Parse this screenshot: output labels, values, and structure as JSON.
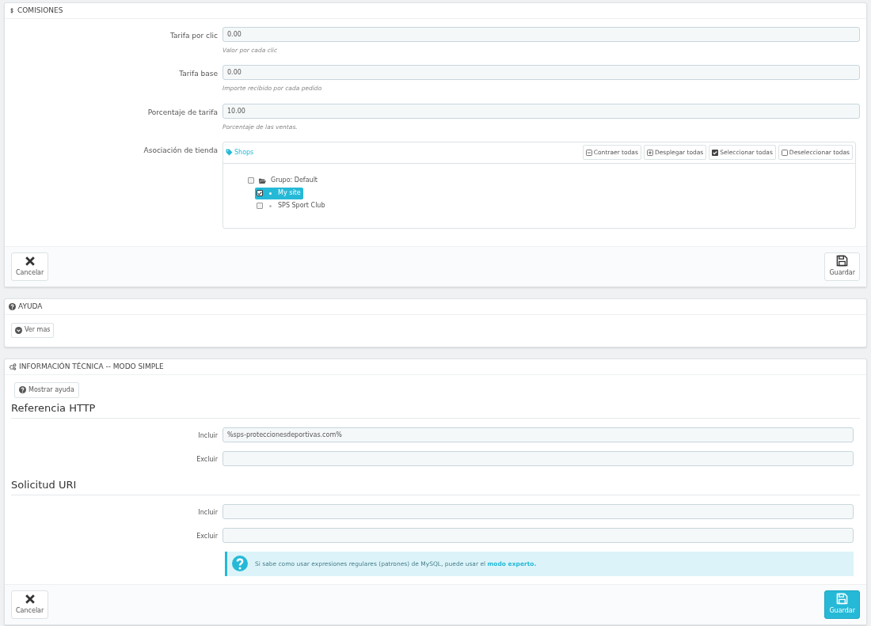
{
  "comisiones": {
    "title": "COMISIONES",
    "fields": [
      {
        "label": "Tarifa por clic",
        "value": "0.00",
        "help": "Valor por cada clic"
      },
      {
        "label": "Tarifa base",
        "value": "0.00",
        "help": "Importe recibido por cada pedido"
      },
      {
        "label": "Porcentaje de tarifa",
        "value": "10.00",
        "help": "Porcentaje de las ventas."
      }
    ],
    "shop_association": {
      "label": "Asociación de tienda",
      "tree_title": "Shops",
      "actions": [
        {
          "label": "Contraer todas",
          "kind": "collapse"
        },
        {
          "label": "Desplegar todas",
          "kind": "expand"
        },
        {
          "label": "Seleccionar todas",
          "kind": "check"
        },
        {
          "label": "Deseleccionar todas",
          "kind": "uncheck"
        }
      ],
      "tree": [
        {
          "label": "Grupo: Default",
          "checked": false,
          "selected": false,
          "children": [
            {
              "label": "My site",
              "checked": true,
              "selected": true
            },
            {
              "label": "SPS Sport Club",
              "checked": false,
              "selected": false
            }
          ]
        }
      ]
    },
    "footer_buttons": [
      {
        "label": "Cancelar",
        "kind": "cancel",
        "primary": false
      },
      {
        "label": "Guardar",
        "kind": "save",
        "primary": false
      }
    ]
  },
  "ayuda": {
    "title": "AYUDA",
    "button": "Ver mas"
  },
  "info": {
    "title": "INFORMACIÓN TÉCNICA -- MODO SIMPLE",
    "help_button": "Mostrar ayuda",
    "sections": [
      {
        "heading": "Referencia HTTP",
        "fields": [
          {
            "label": "Incluir",
            "value": "%sps-proteccionesdeportivas.com%"
          },
          {
            "label": "Excluir"
          }
        ]
      },
      {
        "heading": "Solicitud URI",
        "fields": [
          {
            "label": "Incluir"
          },
          {
            "label": "Excluir"
          }
        ]
      }
    ],
    "alert": {
      "text": "Si sabe como usar expresiones regulares (patrones) de MySQL, puede usar el",
      "link": "modo experto."
    },
    "footer_buttons": [
      {
        "label": "Cancelar",
        "kind": "cancel",
        "primary": false
      },
      {
        "label": "Guardar",
        "kind": "save",
        "primary": true
      }
    ]
  }
}
